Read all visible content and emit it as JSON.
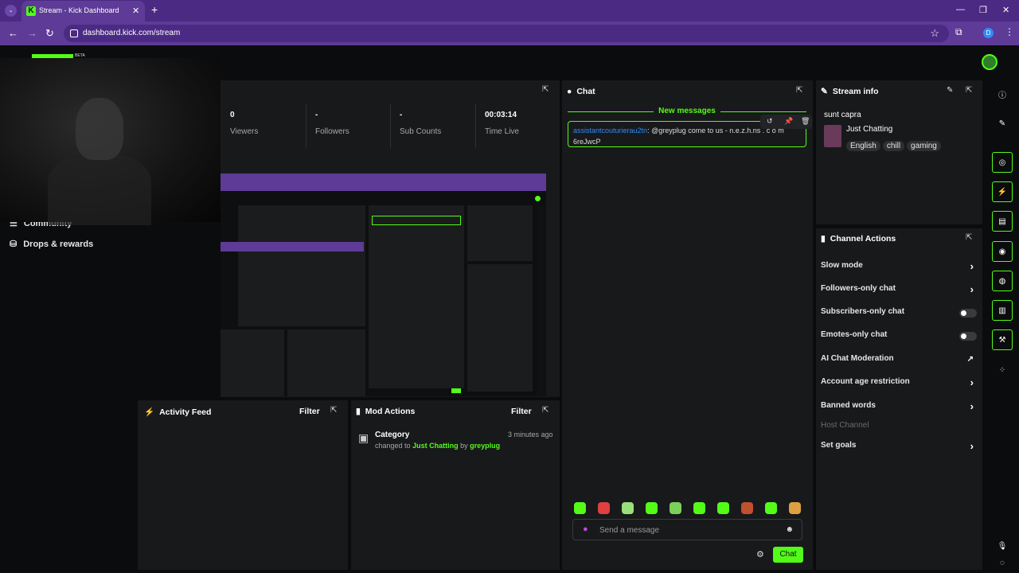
{
  "browser": {
    "tab_title": "Stream - Kick Dashboard",
    "url": "dashboard.kick.com/stream",
    "profile_initial": "D"
  },
  "header": {
    "beta_label": "BETA"
  },
  "sidebar": {
    "items": [
      {
        "label": "Community"
      },
      {
        "label": "Drops & rewards"
      }
    ]
  },
  "stats": [
    {
      "value": "0",
      "label": "Viewers"
    },
    {
      "value": "-",
      "label": "Followers"
    },
    {
      "value": "-",
      "label": "Sub Counts"
    },
    {
      "value": "00:03:14",
      "label": "Time Live"
    }
  ],
  "chat": {
    "title": "Chat",
    "new_messages_label": "New messages",
    "message": {
      "username": "assistantcouturierau2tn",
      "text": ": @greyplug come to us - n.e.z.h.ns . c o m 6reJwcP"
    },
    "input_placeholder": "Send a message",
    "send_label": "Chat"
  },
  "stream_info": {
    "title": "Stream info",
    "stream_title": "sunt capra",
    "category": "Just Chatting",
    "tags": [
      "English",
      "chill",
      "gaming"
    ]
  },
  "channel_actions": {
    "title": "Channel Actions",
    "rows": [
      {
        "label": "Slow mode",
        "control": "chevron"
      },
      {
        "label": "Followers-only chat",
        "control": "chevron"
      },
      {
        "label": "Subscribers-only chat",
        "control": "toggle",
        "on": false
      },
      {
        "label": "Emotes-only chat",
        "control": "toggle",
        "on": false
      },
      {
        "label": "AI Chat Moderation",
        "control": "external"
      },
      {
        "label": "Account age restriction",
        "control": "chevron"
      },
      {
        "label": "Banned words",
        "control": "chevron"
      },
      {
        "label": "Host Channel",
        "control": "none",
        "disabled": true
      },
      {
        "label": "Set goals",
        "control": "chevron"
      }
    ]
  },
  "activity_feed": {
    "title": "Activity Feed",
    "filter_label": "Filter"
  },
  "mod_actions": {
    "title": "Mod Actions",
    "filter_label": "Filter",
    "entry": {
      "heading": "Category",
      "prefix": "changed to",
      "category": "Just Chatting",
      "by": "by",
      "user": "greyplug",
      "time": "3 minutes ago"
    }
  },
  "colors": {
    "accent": "#53fc18",
    "browser_chrome": "#5d3b97",
    "panel": "#18191b",
    "username_link": "#2d8cff"
  }
}
